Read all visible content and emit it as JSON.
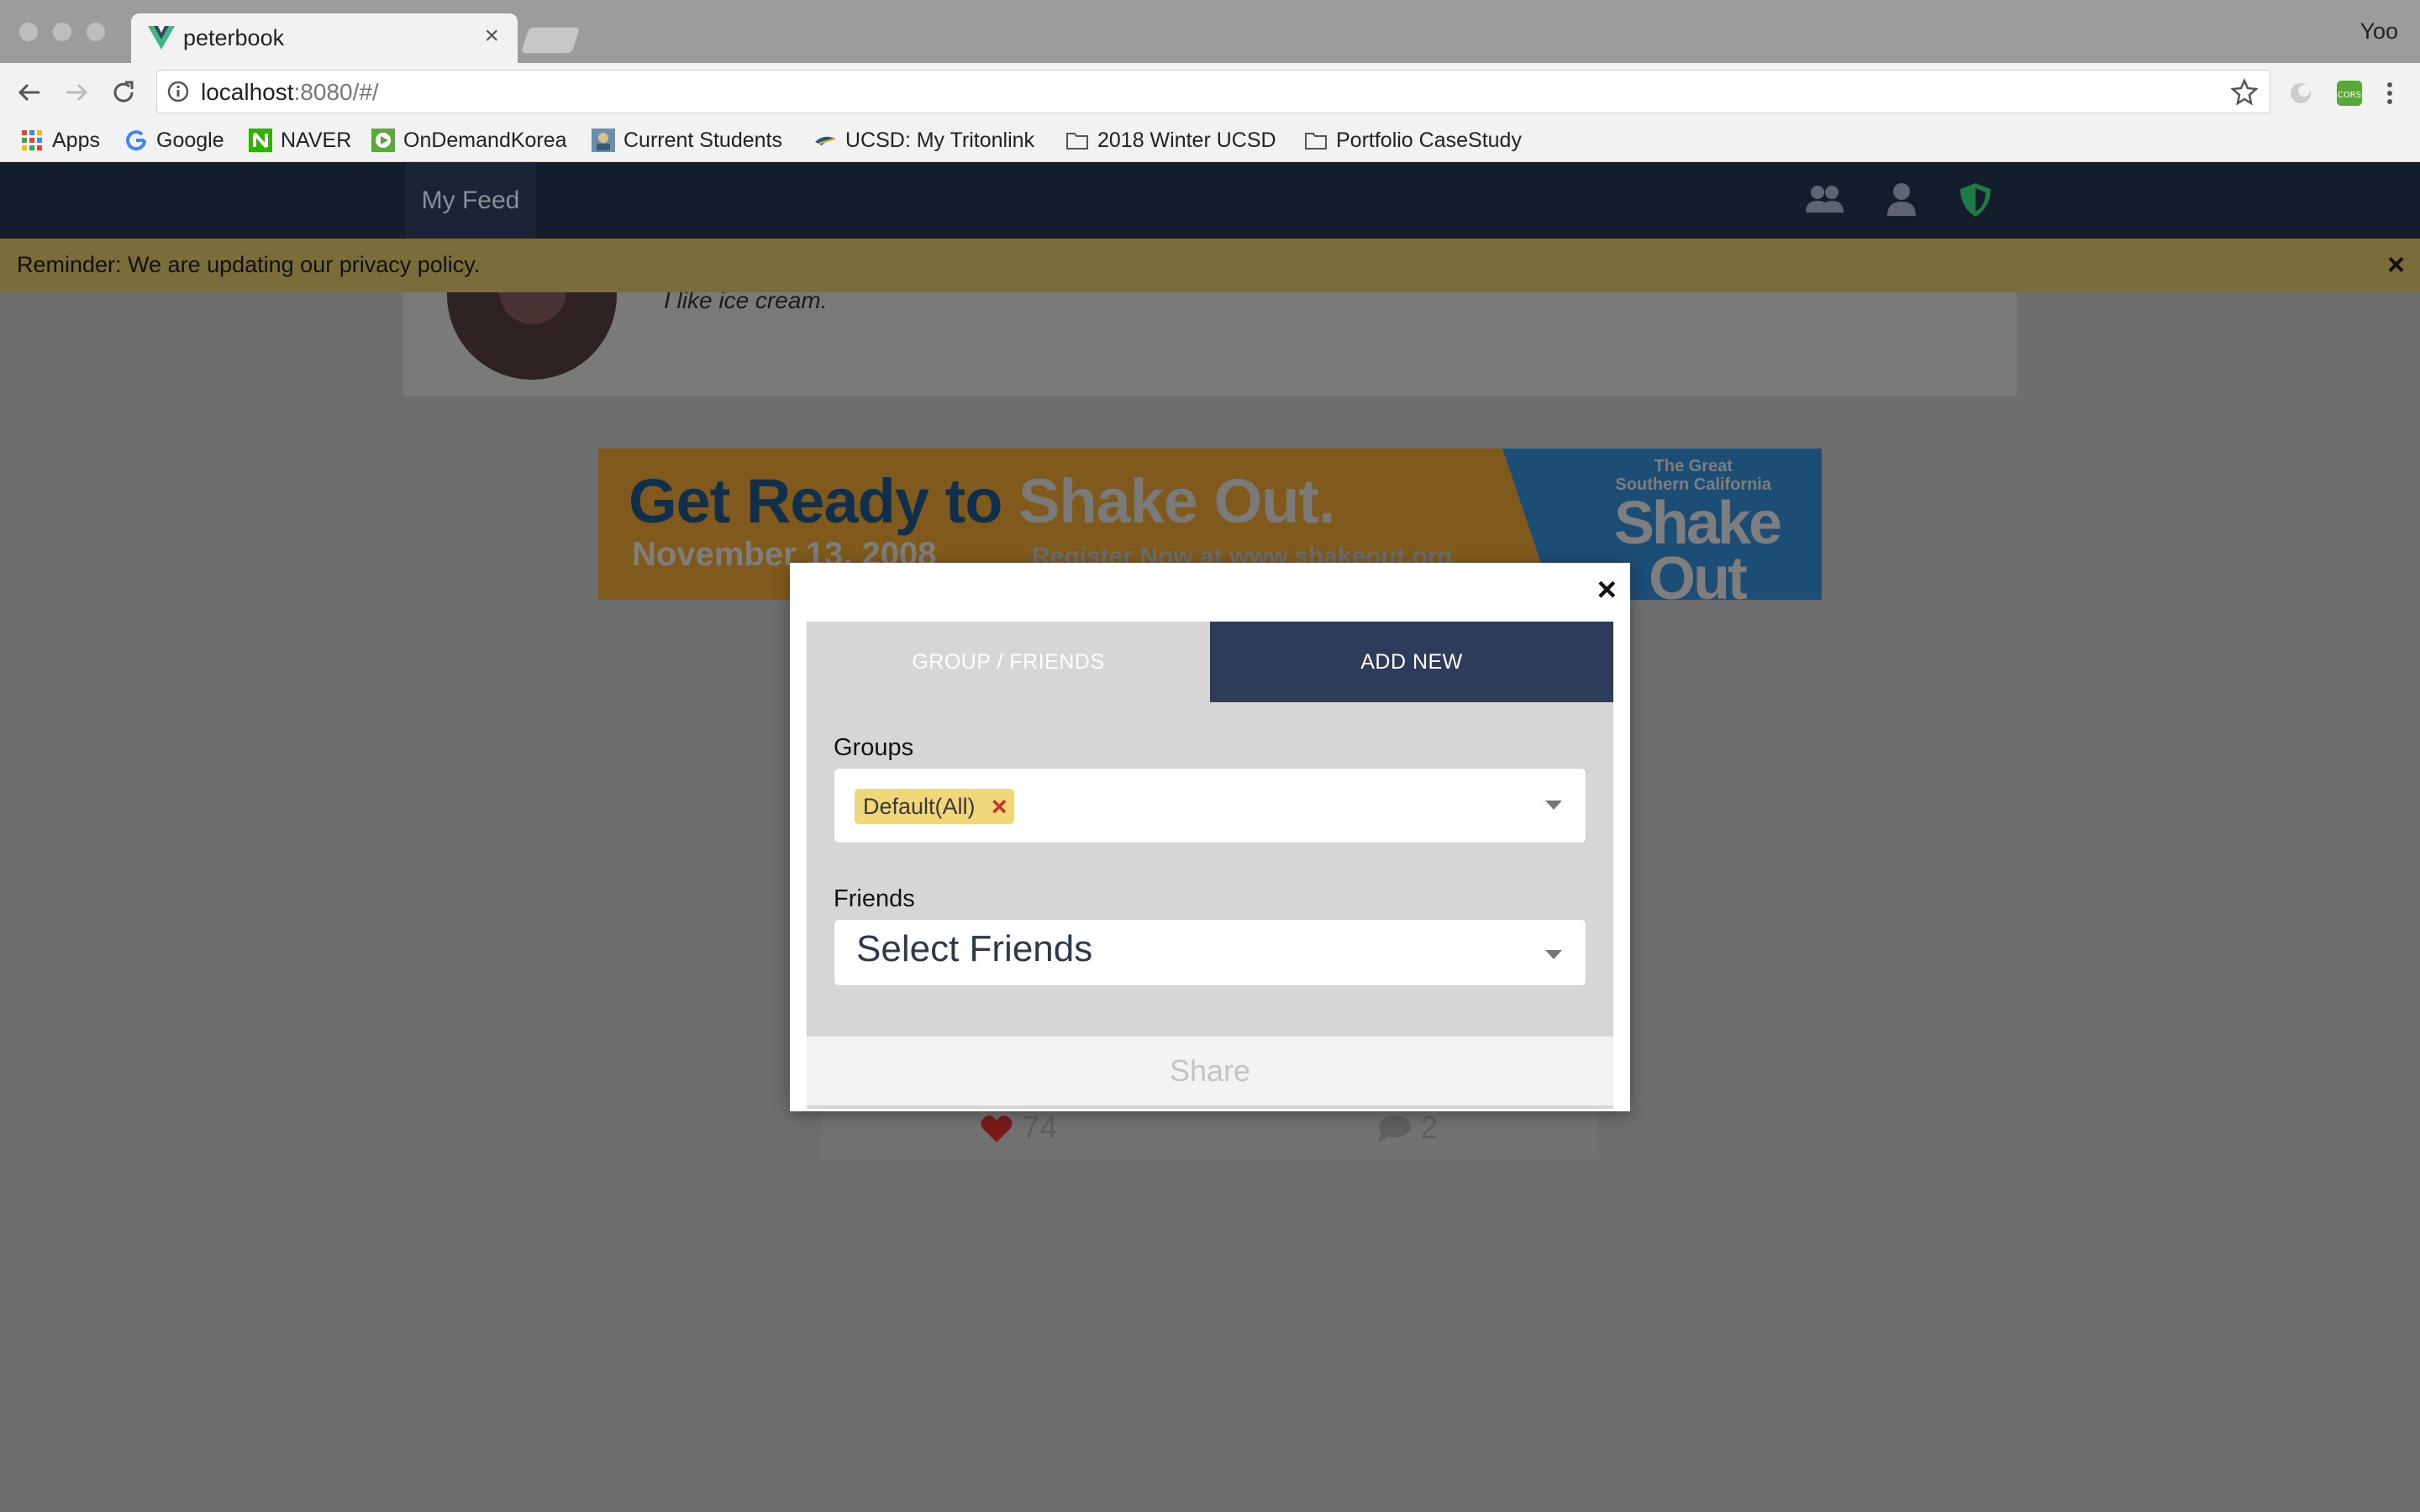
{
  "browser": {
    "tab_title": "peterbook",
    "profile_name": "Yoo",
    "url_host": "localhost",
    "url_rest": ":8080/#/",
    "bookmarks": [
      {
        "label": "Apps",
        "icon": "apps-grid-icon"
      },
      {
        "label": "Google",
        "icon": "google-icon"
      },
      {
        "label": "NAVER",
        "icon": "naver-icon"
      },
      {
        "label": "OnDemandKorea",
        "icon": "ondemandkorea-icon"
      },
      {
        "label": "Current Students",
        "icon": "current-students-icon"
      },
      {
        "label": "UCSD: My Tritonlink",
        "icon": "tritonlink-icon"
      },
      {
        "label": "2018 Winter UCSD",
        "icon": "folder-icon"
      },
      {
        "label": "Portfolio CaseStudy",
        "icon": "folder-icon"
      }
    ]
  },
  "app": {
    "nav_feed": "My Feed",
    "nav_icons": [
      "friends-icon",
      "user-icon",
      "shield-icon"
    ],
    "reminder": "Reminder: We are updating our privacy policy.",
    "reminder_close": "×",
    "bio": "I like ice cream.",
    "ad": {
      "headline_a": "Get Ready to",
      "headline_b": "Shake Out.",
      "date": "November 13, 2008",
      "register": "Register Now at www.shakeout.org",
      "brand_small_1": "The Great",
      "brand_small_2": "Southern California",
      "brand_big_1": "Shake",
      "brand_big_2": "Out"
    },
    "likes": "74",
    "comments": "2"
  },
  "modal": {
    "close": "×",
    "tab_group_friends": "GROUP / FRIENDS",
    "tab_add_new": "ADD NEW",
    "groups_label": "Groups",
    "groups_selected": "Default(All)",
    "chip_remove": "×",
    "friends_label": "Friends",
    "friends_placeholder": "Select Friends",
    "share": "Share"
  },
  "colors": {
    "navbar": "#141d2b",
    "active_tab": "#2d3c59",
    "chip": "#f0d87a",
    "chip_remove": "#c9302c",
    "reminder_bar": "#7a6d3a"
  }
}
